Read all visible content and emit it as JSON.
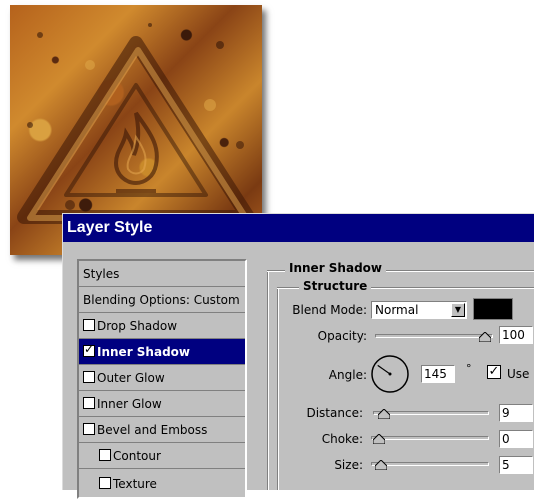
{
  "dialog": {
    "title": "Layer Style"
  },
  "styles_list": [
    {
      "label": "Styles",
      "checkbox": false,
      "checked": false,
      "selected": false
    },
    {
      "label": "Blending Options: Custom",
      "checkbox": false,
      "checked": false,
      "selected": false
    },
    {
      "label": "Drop Shadow",
      "checkbox": true,
      "checked": false,
      "selected": false
    },
    {
      "label": "Inner Shadow",
      "checkbox": true,
      "checked": true,
      "selected": true
    },
    {
      "label": "Outer Glow",
      "checkbox": true,
      "checked": false,
      "selected": false
    },
    {
      "label": "Inner Glow",
      "checkbox": true,
      "checked": false,
      "selected": false
    },
    {
      "label": "Bevel and Emboss",
      "checkbox": true,
      "checked": false,
      "selected": false
    },
    {
      "label": "Contour",
      "checkbox": true,
      "checked": false,
      "selected": false
    },
    {
      "label": "Texture",
      "checkbox": true,
      "checked": false,
      "selected": false
    }
  ],
  "panel": {
    "section_title": "Inner Shadow",
    "group_title": "Structure",
    "blend_mode": {
      "label": "Blend Mode:",
      "value": "Normal",
      "color": "#000000"
    },
    "opacity": {
      "label": "Opacity:",
      "value": "100",
      "unit": "%",
      "level": 1.0
    },
    "angle": {
      "label": "Angle:",
      "value": "145",
      "unit": "°",
      "degrees": 145,
      "global_light_label": "Use",
      "global_light_checked": true
    },
    "distance": {
      "label": "Distance:",
      "value": "9",
      "level": 0.03
    },
    "choke": {
      "label": "Choke:",
      "value": "0",
      "level": 0.0
    },
    "size": {
      "label": "Size:",
      "value": "5",
      "level": 0.02
    }
  },
  "colors": {
    "titlebar": "#000080",
    "selection": "#000080",
    "dialog_bg": "#c0c0c0"
  }
}
